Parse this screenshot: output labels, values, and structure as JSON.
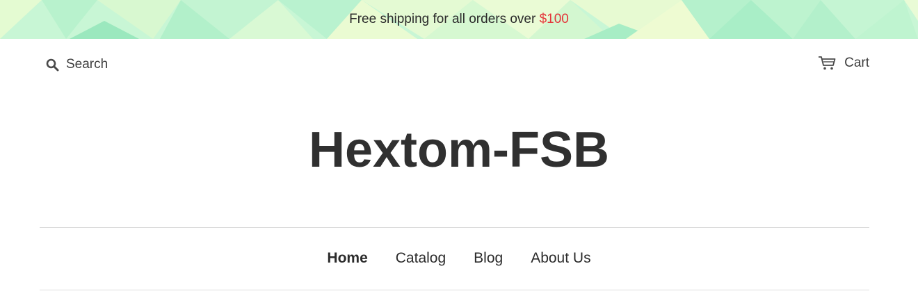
{
  "announcement": {
    "text": "Free shipping for all orders over ",
    "amount": "$100"
  },
  "header": {
    "search_label": "Search",
    "cart_label": "Cart"
  },
  "logo": {
    "text": "Hextom-FSB"
  },
  "nav": {
    "items": [
      {
        "label": "Home",
        "active": true
      },
      {
        "label": "Catalog",
        "active": false
      },
      {
        "label": "Blog",
        "active": false
      },
      {
        "label": "About Us",
        "active": false
      }
    ]
  },
  "colors": {
    "announcement_background": "#c6f5d3",
    "announcement_amount": "#e4353a",
    "text": "#333333",
    "divider": "#dcdcdc"
  },
  "icons": {
    "search": "search-icon",
    "cart": "cart-icon"
  }
}
